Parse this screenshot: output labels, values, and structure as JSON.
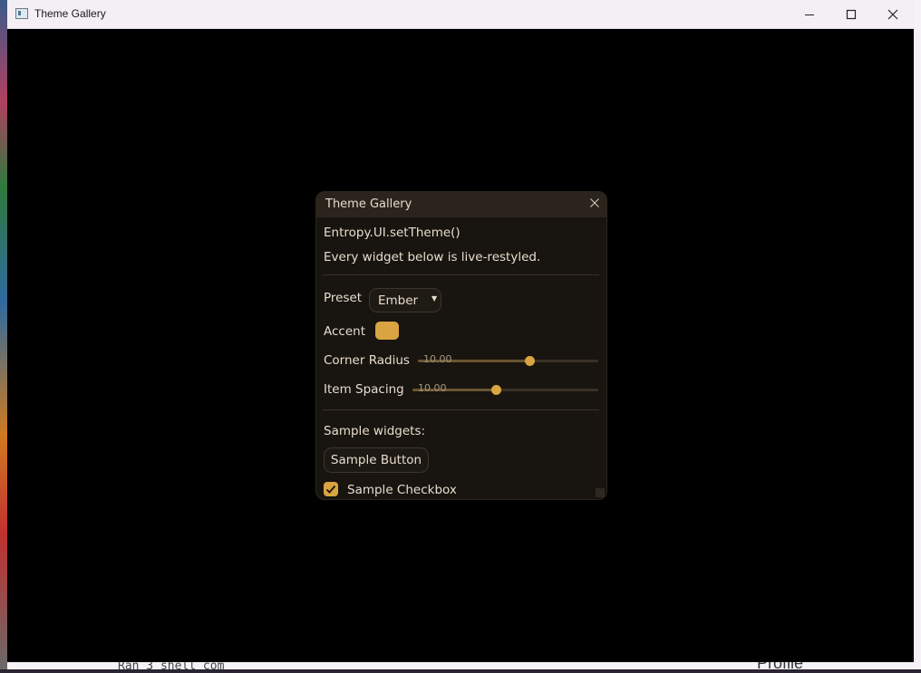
{
  "os_window": {
    "title": "Theme Gallery",
    "controls": {
      "minimize": "minimize-icon",
      "maximize": "maximize-icon",
      "close": "close-icon"
    }
  },
  "panel": {
    "title": "Theme Gallery",
    "api_text": "Entropy.UI.setTheme()",
    "description": "Every widget below is live-restyled.",
    "preset": {
      "label": "Preset",
      "value": "Ember"
    },
    "accent": {
      "label": "Accent",
      "color": "#d9a441"
    },
    "corner_radius": {
      "label": "Corner Radius",
      "value_text": "10.00",
      "fraction": 0.62
    },
    "item_spacing": {
      "label": "Item Spacing",
      "value_text": "10.00",
      "fraction": 0.45
    },
    "sample_heading": "Sample widgets:",
    "sample_button": "Sample Button",
    "sample_checkbox": {
      "label": "Sample Checkbox",
      "checked": true
    }
  },
  "background": {
    "terminal_text": "Ran 3 shell com",
    "profile_text": "Profile"
  },
  "colors": {
    "accent": "#d9a441",
    "panel_bg": "#18140f",
    "panel_header": "#2a241d",
    "text": "#e8ddce"
  }
}
